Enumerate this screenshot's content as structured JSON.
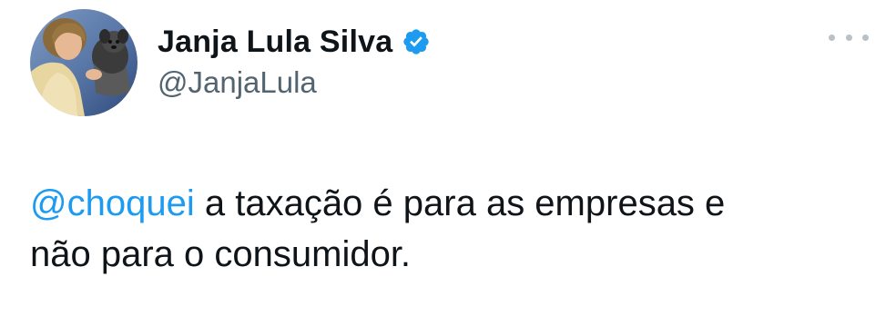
{
  "author": {
    "display_name": "Janja Lula Silva",
    "handle": "@JanjaLula",
    "verified": true,
    "avatar_icon": "profile-photo-with-dog"
  },
  "tweet": {
    "mention": "@choquei",
    "text_line1": " a taxação é para as empresas e",
    "text_line2": "não para o consumidor."
  },
  "more_icon": "more-options-icon",
  "colors": {
    "link": "#1d9bf0",
    "text": "#0f1419",
    "secondary": "#536471",
    "verified_badge": "#1d9bf0"
  }
}
